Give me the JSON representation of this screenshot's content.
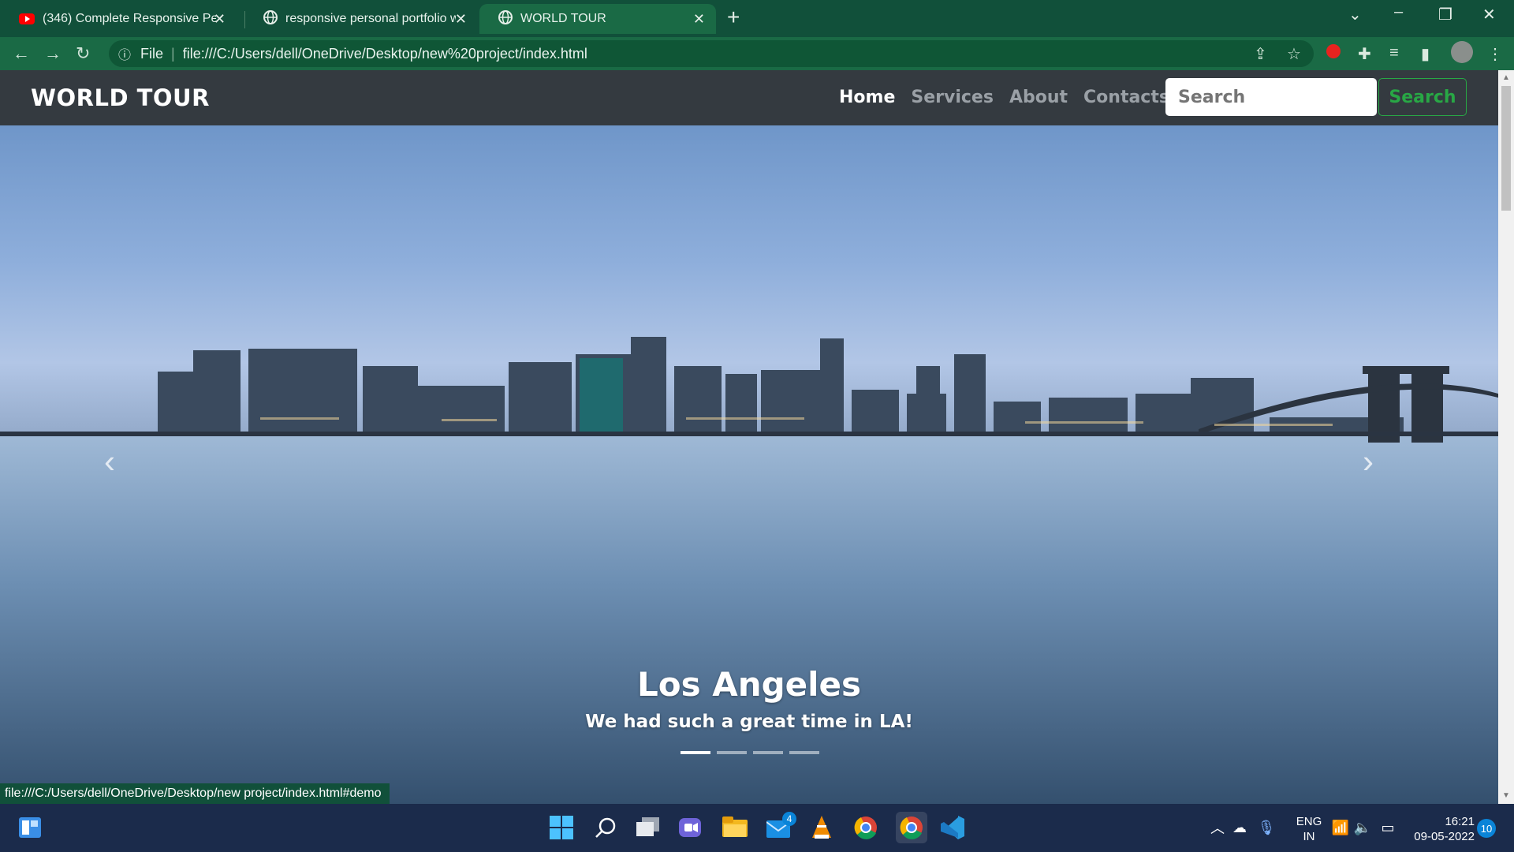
{
  "browser": {
    "tabs": [
      {
        "title": "(346) Complete Responsive Perso",
        "icon": "youtube-icon"
      },
      {
        "title": "responsive personal portfolio we",
        "icon": "globe-icon"
      },
      {
        "title": "WORLD TOUR",
        "icon": "globe-icon"
      }
    ],
    "address": {
      "scheme_label": "File",
      "url": "file:///C:/Users/dell/OneDrive/Desktop/new%20project/index.html"
    },
    "status_link": "file:///C:/Users/dell/OneDrive/Desktop/new project/index.html#demo"
  },
  "site": {
    "brand": "WORLD TOUR",
    "nav": {
      "home": "Home",
      "services": "Services",
      "about": "About",
      "contacts": "Contacts"
    },
    "search": {
      "placeholder": "Search",
      "button": "Search"
    },
    "carousel": {
      "slide_title": "Los Angeles",
      "slide_subtitle": "We had such a great time in LA!",
      "indicator_count": 4,
      "active_index": 0
    }
  },
  "taskbar": {
    "language_line1": "ENG",
    "language_line2": "IN",
    "time": "16:21",
    "date": "09-05-2022",
    "notification_count": "10",
    "mail_badge": "4"
  },
  "colors": {
    "browser_frame": "#11503a",
    "navbar": "#343a40",
    "search_button": "#28a745",
    "taskbar": "#1b2b4b"
  }
}
